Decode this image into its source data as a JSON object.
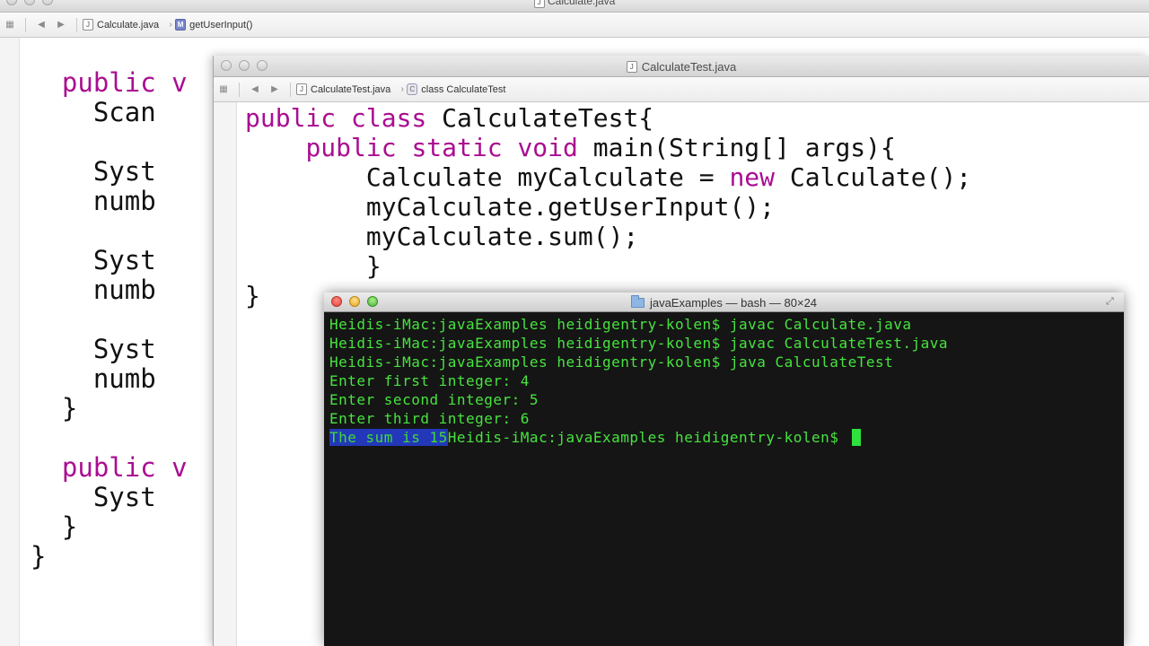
{
  "back_window": {
    "title": "Calculate.java",
    "breadcrumb": [
      {
        "label": "Calculate.java",
        "icon": "java-file-icon"
      },
      {
        "label": "getUserInput()",
        "icon": "method-icon"
      }
    ],
    "code_lines": [
      [
        "public v",
        ""
      ],
      [
        "",
        "Scan"
      ],
      [
        "",
        ""
      ],
      [
        "",
        "Syst"
      ],
      [
        "",
        "numb"
      ],
      [
        "",
        ""
      ],
      [
        "",
        "Syst"
      ],
      [
        "",
        "numb"
      ],
      [
        "",
        ""
      ],
      [
        "",
        "Syst"
      ],
      [
        "",
        "numb"
      ],
      [
        "}",
        ""
      ],
      [
        "",
        ""
      ],
      [
        "public v",
        ""
      ],
      [
        "",
        "Syst"
      ],
      [
        "}",
        ""
      ],
      [
        "}",
        ""
      ]
    ]
  },
  "front_window": {
    "title": "CalculateTest.java",
    "breadcrumb": [
      {
        "label": "CalculateTest.java",
        "icon": "java-file-icon"
      },
      {
        "label": "class CalculateTest",
        "icon": "class-icon"
      }
    ],
    "code": {
      "l1_kw": "public class",
      "l1_rest": " CalculateTest{",
      "l2_kw": "public static void",
      "l2_rest": " main(String[] args){",
      "l3_a": "Calculate myCalculate = ",
      "l3_kw": "new",
      "l3_b": " Calculate();",
      "l4": "myCalculate.getUserInput();",
      "l5": "myCalculate.sum();",
      "l6": "}",
      "l7": "}"
    }
  },
  "terminal": {
    "title": "javaExamples — bash — 80×24",
    "lines": [
      "Heidis-iMac:javaExamples heidigentry-kolen$ javac Calculate.java",
      "Heidis-iMac:javaExamples heidigentry-kolen$ javac CalculateTest.java",
      "Heidis-iMac:javaExamples heidigentry-kolen$ java CalculateTest",
      "Enter first integer: 4",
      "Enter second integer: 5",
      "Enter third integer: 6"
    ],
    "last_line_selected": "The sum is 15",
    "last_line_prompt": "Heidis-iMac:javaExamples heidigentry-kolen$ ",
    "colors": {
      "background": "#151515",
      "text": "#47e33f",
      "selection": "#2238b8"
    }
  }
}
